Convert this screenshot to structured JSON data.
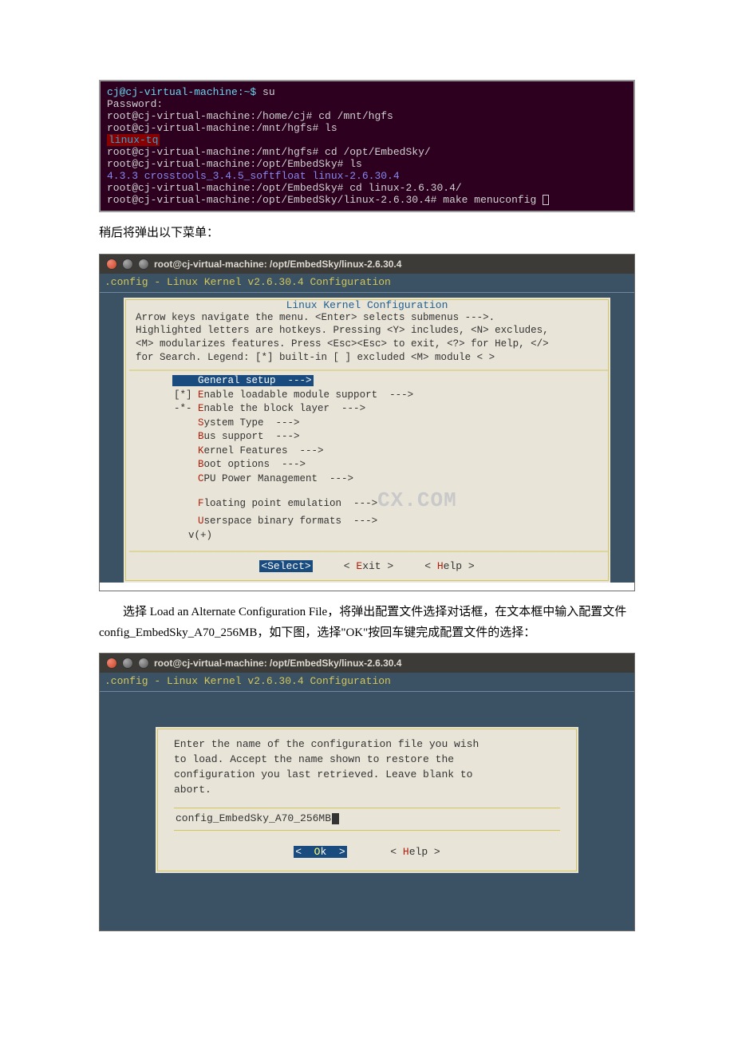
{
  "terminal1": {
    "line1_user": "cj@cj-virtual-machine",
    "line1_path": ":~$ ",
    "line1_cmd": "su",
    "line2": "Password:",
    "line3": "root@cj-virtual-machine:/home/cj# cd /mnt/hgfs",
    "line4": "root@cj-virtual-machine:/mnt/hgfs# ls",
    "line5": "linux-tq",
    "line6": "root@cj-virtual-machine:/mnt/hgfs# cd /opt/EmbedSky/",
    "line7": "root@cj-virtual-machine:/opt/EmbedSky# ls",
    "line8": "4.3.3  crosstools_3.4.5_softfloat  linux-2.6.30.4",
    "line9": "root@cj-virtual-machine:/opt/EmbedSky# cd linux-2.6.30.4/",
    "line10": "root@cj-virtual-machine:/opt/EmbedSky/linux-2.6.30.4# make menuconfig "
  },
  "doc": {
    "p1": "稍后将弹出以下菜单：",
    "p2_a": "选择 Load an Alternate Configuration File，将弹出配置文件选择对话框，在文本框中输入配置文件 config_EmbedSky_A70_256MB，如下图，选择\"OK\"按回车键完成配置文件的选择："
  },
  "win1": {
    "title": "root@cj-virtual-machine: /opt/EmbedSky/linux-2.6.30.4",
    "config_label": ".config - Linux Kernel v2.6.30.4 Configuration",
    "menu_title": "Linux Kernel Configuration",
    "help1": "Arrow keys navigate the menu.  <Enter> selects submenus --->.",
    "help2": "Highlighted letters are hotkeys.  Pressing <Y> includes, <N> excludes,",
    "help3": "<M> modularizes features.  Press <Esc><Esc> to exit, <?> for Help, </>",
    "help4": "for Search.  Legend: [*] built-in  [ ] excluded  <M> module  < >",
    "items": {
      "i0": "    General setup  --->",
      "i1_pre": "[*] ",
      "i1_hk": "E",
      "i1_rest": "nable loadable module support  --->",
      "i2_pre": "-*- ",
      "i2_hk": "E",
      "i2_rest": "nable the block layer  --->",
      "i3_pre": "    ",
      "i3_hk": "S",
      "i3_rest": "ystem Type  --->",
      "i4_pre": "    ",
      "i4_hk": "B",
      "i4_rest": "us support  --->",
      "i5_pre": "    ",
      "i5_hk": "K",
      "i5_rest": "ernel Features  --->",
      "i6_pre": "    ",
      "i6_hk": "B",
      "i6_rest": "oot options  --->",
      "i7_pre": "    ",
      "i7_hk": "C",
      "i7_rest": "PU Power Management  --->",
      "i8_pre": "    ",
      "i8_hk": "F",
      "i8_rest": "loating point emulation  --->",
      "i9_pre": "    ",
      "i9_hk": "U",
      "i9_rest": "serspace binary formats  --->"
    },
    "scroll": "v(+)",
    "buttons": {
      "select": "<Select>",
      "exit": "< Exit >",
      "help": "< Help >",
      "exit_hk": "E",
      "help_hk": "H"
    },
    "watermark": "CX.COM"
  },
  "win2": {
    "title": "root@cj-virtual-machine: /opt/EmbedSky/linux-2.6.30.4",
    "config_label": ".config - Linux Kernel v2.6.30.4 Configuration",
    "dialog_text_l1": "Enter the name of the configuration file you wish",
    "dialog_text_l2": "to load.  Accept the name shown to restore the",
    "dialog_text_l3": "configuration you last retrieved.  Leave blank to",
    "dialog_text_l4": "abort.",
    "input_value": "config_EmbedSky_A70_256MB",
    "buttons": {
      "ok": "<  Ok  >",
      "help": "< Help >",
      "ok_hk": "O",
      "help_hk": "H"
    }
  }
}
